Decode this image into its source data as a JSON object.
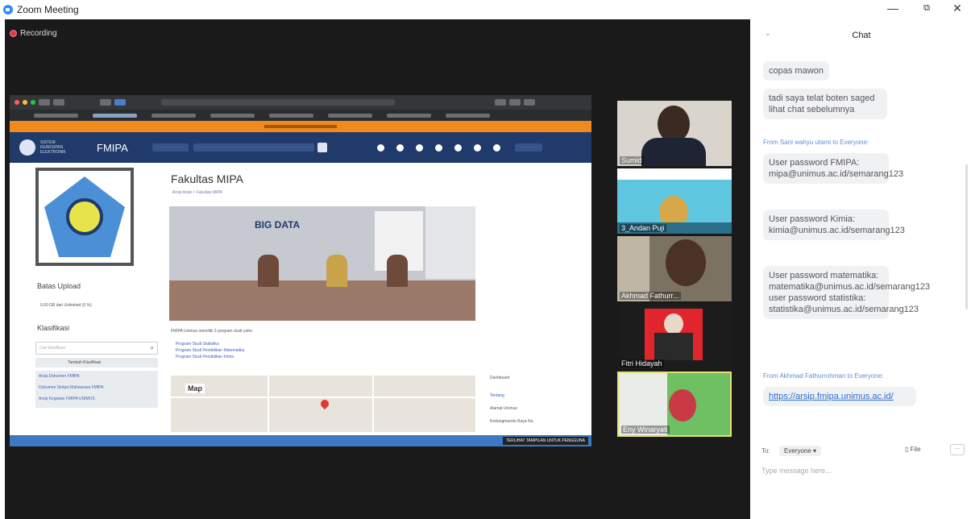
{
  "window": {
    "title": "Zoom Meeting",
    "minimize": "—",
    "restore": "⧉",
    "close": "✕"
  },
  "recording": {
    "label": "Recording"
  },
  "shared_screen": {
    "site_name_lines": "SISTEM KEARSIPAN ELEKTRONIK",
    "site_title": "FMIPA",
    "page_title": "Fakultas MIPA",
    "breadcrumb": "Arsip Arsip > Fakultas MIPA",
    "banner_text": "BIG DATA",
    "sidebar_upload_heading": "Batas Upload",
    "sidebar_upload_value": "0,00 GB dari Unlimited (0 %)",
    "sidebar_class_heading": "Klasifikasi",
    "sidebar_search_placeholder": "Cari klasifikasi",
    "sidebar_add_button": "Tambah Klasifikasi",
    "sidebar_links": [
      "Arsip Dokumen FMIPA",
      "Dokumen Skripsi Mahasiswa FMIPA",
      "Arsip Kegiatan FMIPA UNIMUS"
    ],
    "program_intro": "FMIPA Unimus memiliki 3 program studi yaitu:",
    "programs": [
      "Program Studi Statistika",
      "Program Studi Pendidikan Matematika",
      "Program Studi Pendidikan Kimia"
    ],
    "map_label": "Map",
    "right_heading": "Dashboard",
    "right_items": [
      "Tentang",
      "Alamat Unimus",
      "Kedungmundu Raya No."
    ],
    "footer_note": "TERLIHAT TAMPILAN UNTUK PENGGUNA"
  },
  "participants": [
    {
      "name": "Sumid"
    },
    {
      "name": "3_Andan Puji"
    },
    {
      "name": "Akhmad Fathurr..."
    },
    {
      "name": "Fitri Hidayah"
    },
    {
      "name": "Eny Winaryati"
    }
  ],
  "chat": {
    "title": "Chat",
    "messages": [
      {
        "text": "copas mawon"
      },
      {
        "text": "tadi saya telat boten saged lihat chat sebelumnya"
      },
      {
        "from": "From Sani wahyu utami to Everyone:"
      },
      {
        "text": "User password FMIPA: mipa@unimus.ac.id/semarang123"
      },
      {
        "text": "User password Kimia: kimia@unimus.ac.id/semarang123"
      },
      {
        "text": "User password matematika: matematika@unimus.ac.id/semarang123 user password statistika: statistika@unimus.ac.id/semarang123"
      },
      {
        "from": "From Akhmad Fathurrohman to Everyone:"
      },
      {
        "link": "https://arsip.fmipa.unimus.ac.id/"
      }
    ],
    "to_label": "To:",
    "recipient": "Everyone ▾",
    "file_label": "File",
    "more_label": "···",
    "input_placeholder": "Type message here..."
  },
  "colors": {
    "zoom_blue": "#2d8cff",
    "fmipa_nav": "#1f3a6b",
    "orange_bar": "#f08a1c",
    "active_speaker": "#e4e26e"
  }
}
